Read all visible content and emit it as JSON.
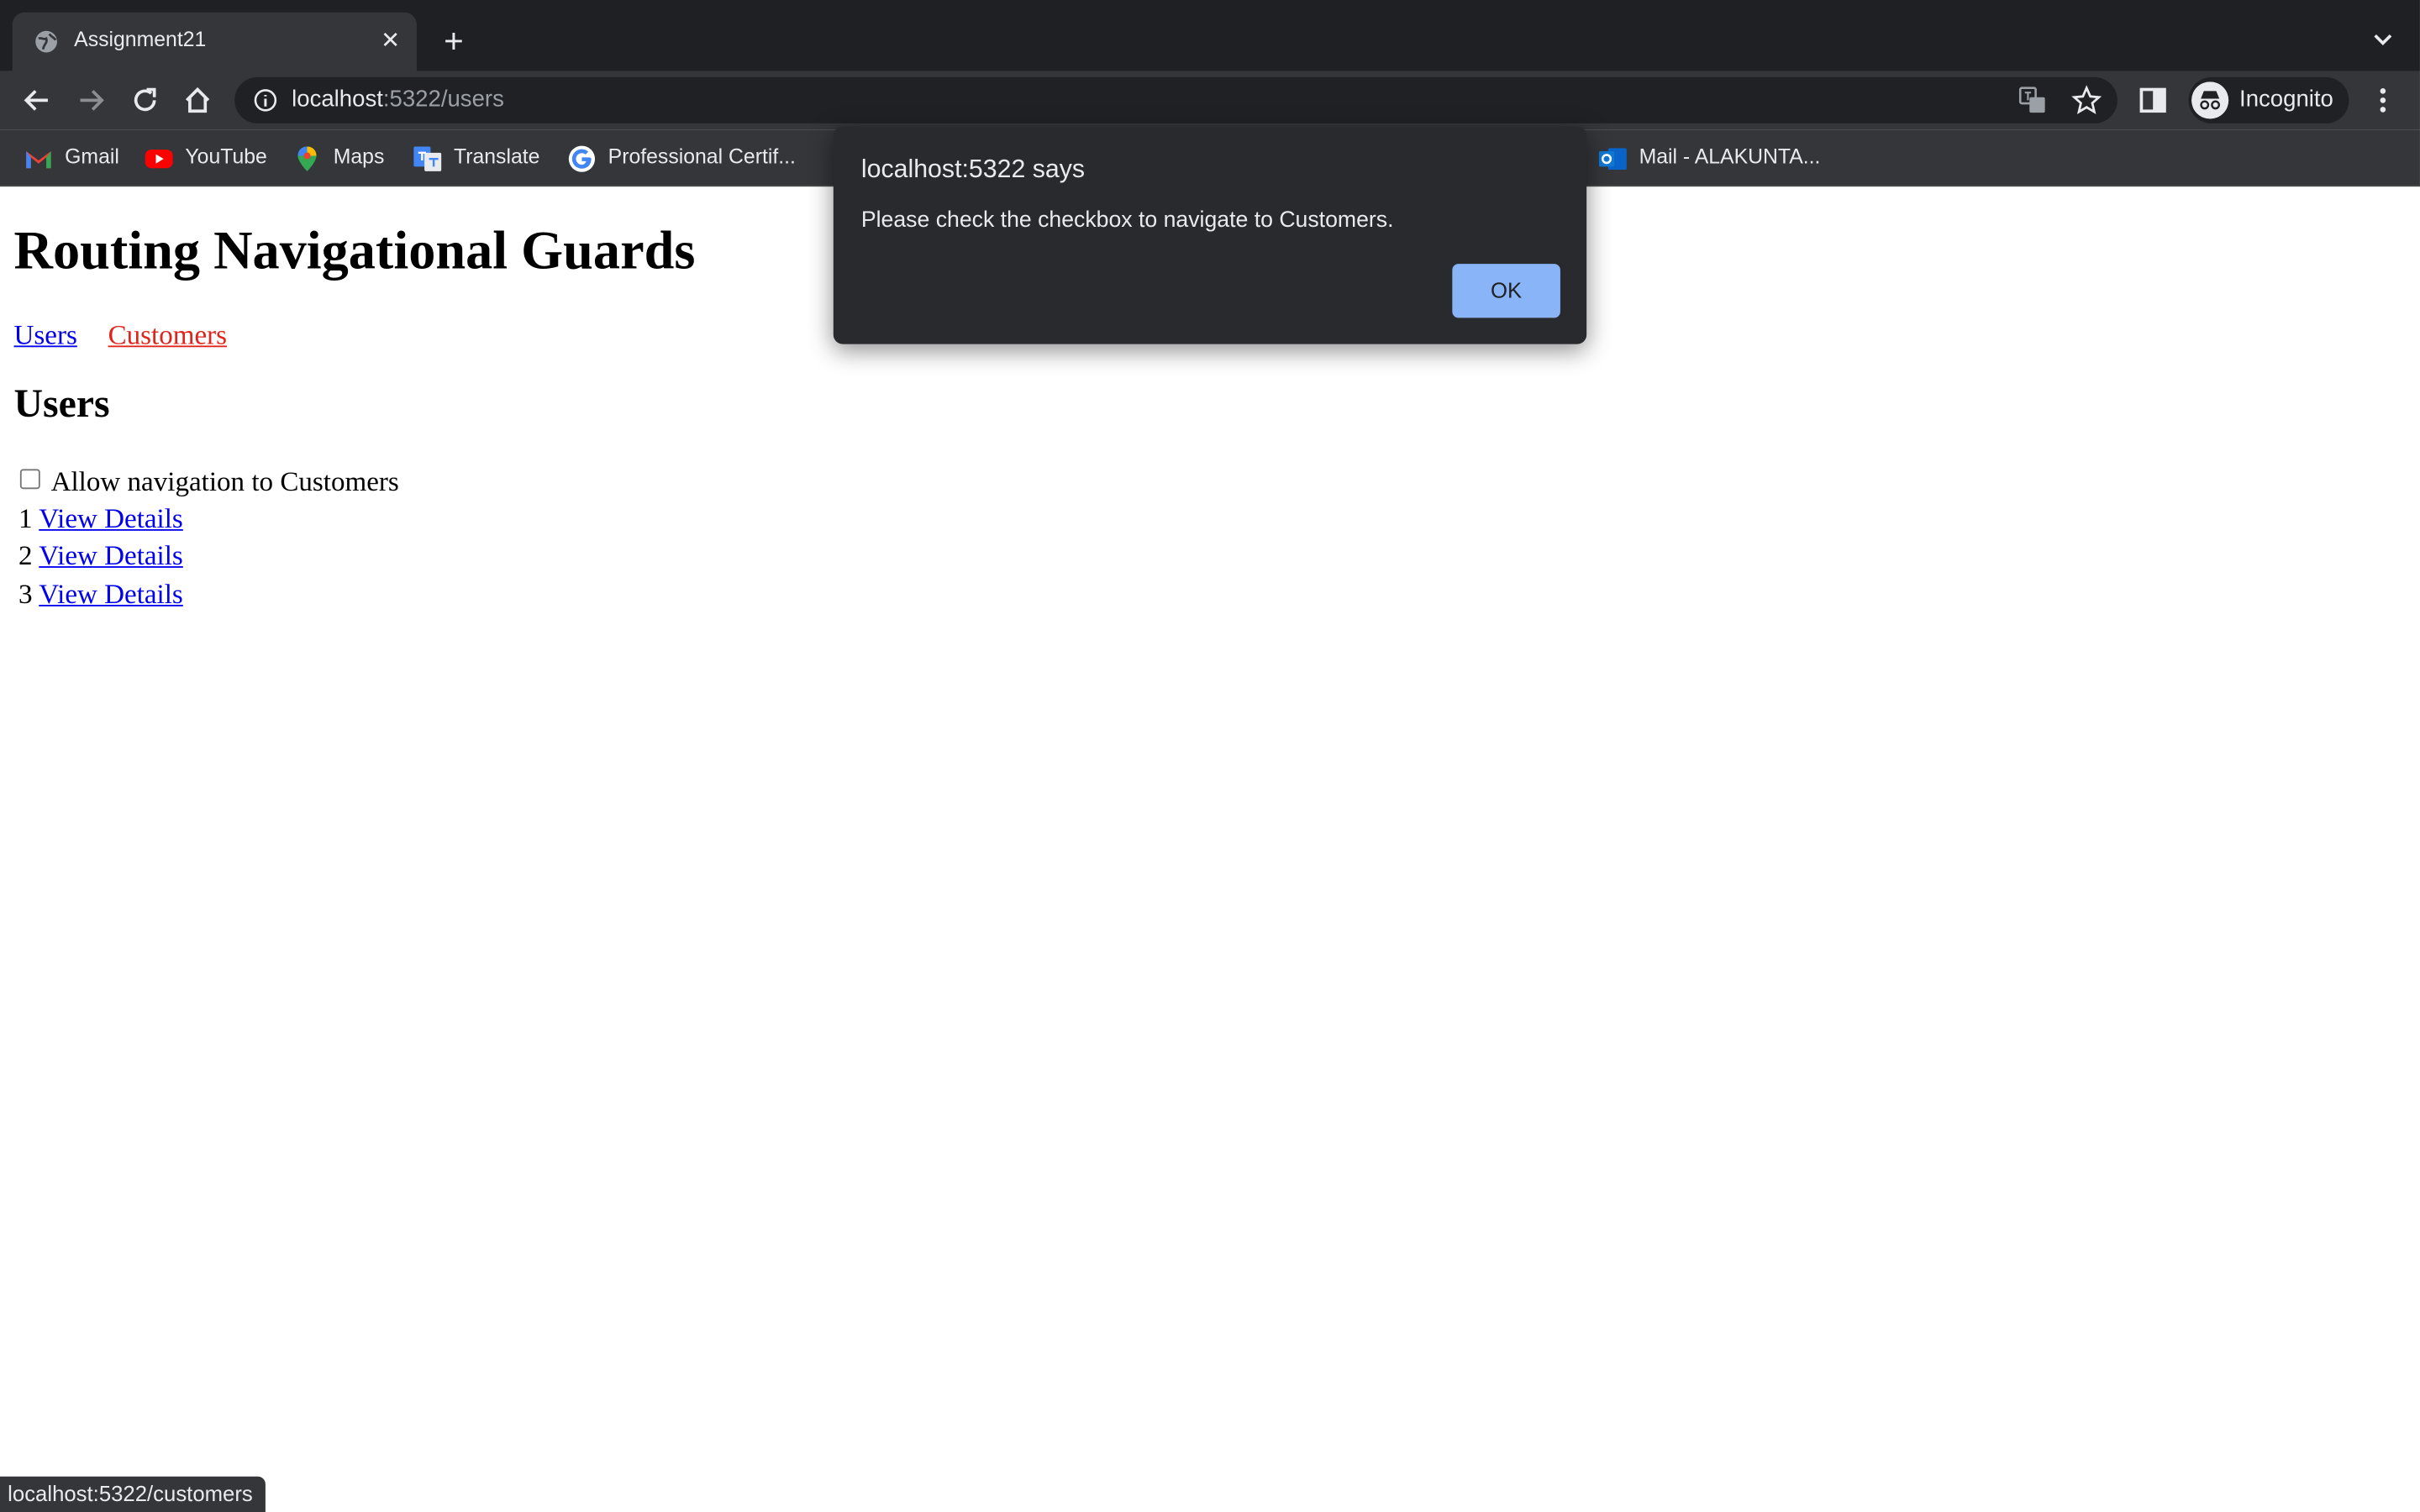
{
  "browser": {
    "tab": {
      "title": "Assignment21"
    },
    "address": {
      "host": "localhost",
      "path": ":5322/users"
    },
    "profile": {
      "label": "Incognito"
    },
    "bookmarks": [
      {
        "label": "Gmail",
        "icon": "gmail-icon"
      },
      {
        "label": "YouTube",
        "icon": "youtube-icon"
      },
      {
        "label": "Maps",
        "icon": "maps-icon"
      },
      {
        "label": "Translate",
        "icon": "translate-icon"
      },
      {
        "label": "Professional Certif...",
        "icon": "google-icon"
      },
      {
        "label": "Mail - ALAKUNTA...",
        "icon": "outlook-icon"
      }
    ]
  },
  "page": {
    "heading": "Routing Navigational Guards",
    "nav": {
      "users": "Users",
      "customers": "Customers"
    },
    "section_title": "Users",
    "checkbox_label": "Allow navigation to Customers",
    "users": [
      {
        "id": "1",
        "link": "View Details"
      },
      {
        "id": "2",
        "link": "View Details"
      },
      {
        "id": "3",
        "link": "View Details"
      }
    ]
  },
  "dialog": {
    "title": "localhost:5322 says",
    "message": "Please check the checkbox to navigate to Customers.",
    "ok_label": "OK"
  },
  "status_bar": {
    "text": "localhost:5322/customers"
  },
  "colors": {
    "visited_link": "#e0241b",
    "link": "#0000ee",
    "dialog_button": "#8ab4f8"
  }
}
